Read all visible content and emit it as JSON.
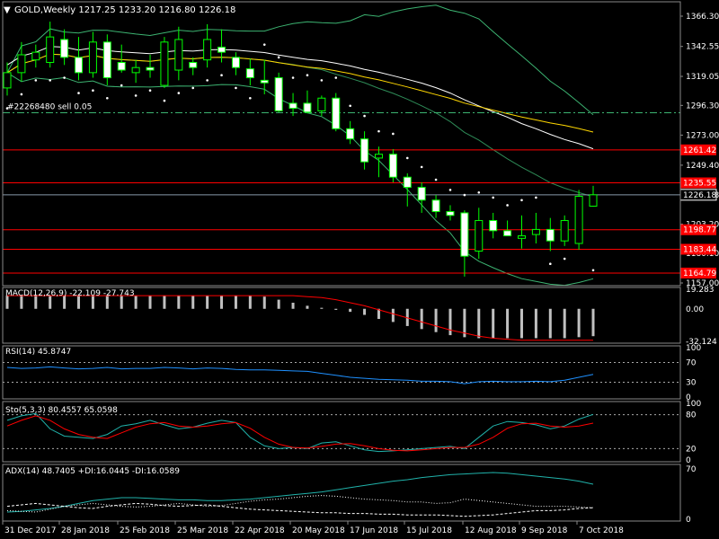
{
  "chart_data": {
    "type": "candlestick",
    "symbol": "GOLD",
    "timeframe": "Weekly",
    "ohlc_readout": "1217.25 1233.20 1216.80 1226.18",
    "price": 1226.18,
    "price_label": "1226.18",
    "order_label": "#22268480 sell 0.05",
    "order_price": 1290.5,
    "price_axis": {
      "min": 1157.0,
      "max": 1366.3,
      "ticks": [
        "1366.30",
        "1342.55",
        "1319.05",
        "1296.30",
        "1273.00",
        "1249.40",
        "1226.18",
        "1203.20",
        "1180.10",
        "1157.00"
      ]
    },
    "levels": [
      {
        "value": 1261.42,
        "label": "1261.42"
      },
      {
        "value": 1235.55,
        "label": "1235.55"
      },
      {
        "value": 1198.77,
        "label": "1198.77"
      },
      {
        "value": 1183.44,
        "label": "1183.44"
      },
      {
        "value": 1164.79,
        "label": "1164.79"
      }
    ],
    "candles": [
      {
        "o": 1310,
        "h": 1330,
        "l": 1304,
        "c": 1322
      },
      {
        "o": 1322,
        "h": 1346,
        "l": 1315,
        "c": 1336
      },
      {
        "o": 1332,
        "h": 1344,
        "l": 1326,
        "c": 1338
      },
      {
        "o": 1330,
        "h": 1362,
        "l": 1326,
        "c": 1350
      },
      {
        "o": 1348,
        "h": 1356,
        "l": 1328,
        "c": 1334
      },
      {
        "o": 1334,
        "h": 1350,
        "l": 1316,
        "c": 1322
      },
      {
        "o": 1322,
        "h": 1354,
        "l": 1318,
        "c": 1346
      },
      {
        "o": 1346,
        "h": 1352,
        "l": 1312,
        "c": 1318
      },
      {
        "o": 1330,
        "h": 1344,
        "l": 1322,
        "c": 1324
      },
      {
        "o": 1322,
        "h": 1332,
        "l": 1314,
        "c": 1326
      },
      {
        "o": 1326,
        "h": 1336,
        "l": 1318,
        "c": 1324
      },
      {
        "o": 1312,
        "h": 1350,
        "l": 1310,
        "c": 1346
      },
      {
        "o": 1324,
        "h": 1358,
        "l": 1316,
        "c": 1348
      },
      {
        "o": 1330,
        "h": 1334,
        "l": 1320,
        "c": 1326
      },
      {
        "o": 1332,
        "h": 1360,
        "l": 1326,
        "c": 1348
      },
      {
        "o": 1342,
        "h": 1356,
        "l": 1330,
        "c": 1338
      },
      {
        "o": 1334,
        "h": 1338,
        "l": 1320,
        "c": 1326
      },
      {
        "o": 1325,
        "h": 1333,
        "l": 1312,
        "c": 1318
      },
      {
        "o": 1316,
        "h": 1332,
        "l": 1305,
        "c": 1314
      },
      {
        "o": 1318,
        "h": 1322,
        "l": 1291,
        "c": 1292
      },
      {
        "o": 1298,
        "h": 1306,
        "l": 1288,
        "c": 1294
      },
      {
        "o": 1298,
        "h": 1308,
        "l": 1290,
        "c": 1291
      },
      {
        "o": 1292,
        "h": 1304,
        "l": 1288,
        "c": 1302
      },
      {
        "o": 1302,
        "h": 1306,
        "l": 1276,
        "c": 1278
      },
      {
        "o": 1278,
        "h": 1284,
        "l": 1266,
        "c": 1270
      },
      {
        "o": 1270,
        "h": 1276,
        "l": 1246,
        "c": 1252
      },
      {
        "o": 1255,
        "h": 1264,
        "l": 1240,
        "c": 1258
      },
      {
        "o": 1258,
        "h": 1262,
        "l": 1236,
        "c": 1240
      },
      {
        "o": 1240,
        "h": 1243,
        "l": 1217,
        "c": 1232
      },
      {
        "o": 1232,
        "h": 1236,
        "l": 1212,
        "c": 1222
      },
      {
        "o": 1222,
        "h": 1226,
        "l": 1208,
        "c": 1213
      },
      {
        "o": 1213,
        "h": 1218,
        "l": 1206,
        "c": 1210
      },
      {
        "o": 1212,
        "h": 1214,
        "l": 1162,
        "c": 1178
      },
      {
        "o": 1182,
        "h": 1216,
        "l": 1176,
        "c": 1206
      },
      {
        "o": 1206,
        "h": 1212,
        "l": 1192,
        "c": 1198
      },
      {
        "o": 1198,
        "h": 1206,
        "l": 1196,
        "c": 1194
      },
      {
        "o": 1192,
        "h": 1210,
        "l": 1184,
        "c": 1194
      },
      {
        "o": 1195,
        "h": 1212,
        "l": 1188,
        "c": 1199
      },
      {
        "o": 1199,
        "h": 1208,
        "l": 1182,
        "c": 1190
      },
      {
        "o": 1190,
        "h": 1210,
        "l": 1186,
        "c": 1206
      },
      {
        "o": 1188,
        "h": 1230,
        "l": 1183,
        "c": 1225
      },
      {
        "o": 1217.25,
        "h": 1233.2,
        "l": 1216.8,
        "c": 1226.18
      }
    ],
    "x_labels": [
      "31 Dec 2017",
      "28 Jan 2018",
      "25 Feb 2018",
      "25 Mar 2018",
      "22 Apr 2018",
      "20 May 2018",
      "17 Jun 2018",
      "15 Jul 2018",
      "12 Aug 2018",
      "9 Sep 2018",
      "7 Oct 2018"
    ],
    "macd": {
      "label": "MACD(12,26,9) -22.109 -27.743",
      "range": [
        -32.124,
        19.283
      ],
      "ticks": [
        "19.283",
        "0.00",
        "-32.124"
      ],
      "histogram": [
        13,
        13,
        13,
        13,
        13,
        13,
        13,
        13,
        13,
        13,
        13,
        13,
        13,
        13,
        13,
        13,
        13,
        13,
        12,
        9,
        6,
        3,
        1,
        -1,
        -3,
        -6,
        -10,
        -13,
        -17,
        -20,
        -23,
        -26,
        -28,
        -29,
        -29,
        -29,
        -29,
        -29,
        -29,
        -29,
        -28,
        -27
      ],
      "signal": [
        13,
        13,
        13,
        13,
        13,
        13,
        13,
        13,
        13,
        13,
        13,
        13,
        13,
        13,
        13,
        13,
        13,
        13,
        13,
        13,
        13,
        12,
        11,
        9,
        6,
        3,
        -1,
        -5,
        -9,
        -13,
        -17,
        -21,
        -24,
        -27,
        -29,
        -30,
        -31,
        -31,
        -31,
        -31,
        -31,
        -31
      ]
    },
    "rsi": {
      "label": "RSI(14) 45.8747",
      "ticks": [
        "100",
        "70",
        "30",
        "0"
      ],
      "levels": [
        70,
        30
      ],
      "values": [
        60,
        58,
        59,
        61,
        59,
        57,
        58,
        60,
        57,
        58,
        58,
        60,
        59,
        57,
        59,
        58,
        56,
        55,
        55,
        54,
        53,
        52,
        48,
        44,
        40,
        38,
        36,
        35,
        34,
        32,
        32,
        31,
        27,
        31,
        32,
        31,
        31,
        32,
        31,
        34,
        40,
        45.87
      ]
    },
    "stoch": {
      "label": "Sto(5,3,3) 80.4557 65.0598",
      "ticks": [
        "100",
        "80",
        "20",
        "0"
      ],
      "levels": [
        80,
        20
      ],
      "main": [
        70,
        78,
        82,
        55,
        42,
        40,
        38,
        45,
        60,
        64,
        70,
        62,
        55,
        58,
        65,
        70,
        66,
        40,
        25,
        20,
        22,
        20,
        30,
        32,
        25,
        18,
        15,
        16,
        18,
        20,
        22,
        24,
        20,
        40,
        60,
        68,
        66,
        62,
        55,
        60,
        72,
        80.46
      ],
      "signal": [
        60,
        70,
        78,
        70,
        55,
        45,
        40,
        38,
        48,
        58,
        64,
        66,
        60,
        58,
        60,
        64,
        66,
        56,
        40,
        28,
        22,
        21,
        24,
        28,
        29,
        25,
        20,
        17,
        16,
        18,
        20,
        22,
        22,
        28,
        40,
        56,
        64,
        65,
        60,
        58,
        60,
        65.06
      ]
    },
    "adx": {
      "label": "ADX(14) 48.7405 +DI:16.0445 -DI:16.0589",
      "ticks": [
        "70",
        "0"
      ],
      "adx": [
        10,
        11,
        13,
        15,
        18,
        22,
        26,
        28,
        30,
        30,
        29,
        28,
        27,
        27,
        26,
        26,
        27,
        28,
        30,
        32,
        34,
        36,
        38,
        41,
        44,
        47,
        50,
        53,
        55,
        58,
        60,
        62,
        63,
        64,
        65,
        64,
        62,
        60,
        58,
        56,
        53,
        48.74
      ],
      "plus_di": [
        18,
        20,
        22,
        20,
        18,
        16,
        15,
        18,
        20,
        22,
        21,
        19,
        18,
        19,
        20,
        18,
        16,
        14,
        13,
        12,
        11,
        10,
        9,
        9,
        8,
        8,
        7,
        7,
        6,
        6,
        6,
        5,
        4,
        5,
        6,
        8,
        10,
        12,
        12,
        13,
        15,
        16.04
      ],
      "minus_di": [
        12,
        11,
        10,
        14,
        18,
        20,
        22,
        20,
        18,
        17,
        18,
        20,
        22,
        20,
        18,
        19,
        22,
        25,
        27,
        28,
        30,
        32,
        33,
        32,
        30,
        28,
        27,
        26,
        24,
        24,
        22,
        23,
        28,
        26,
        24,
        22,
        20,
        18,
        18,
        18,
        17,
        16.06
      ]
    }
  }
}
